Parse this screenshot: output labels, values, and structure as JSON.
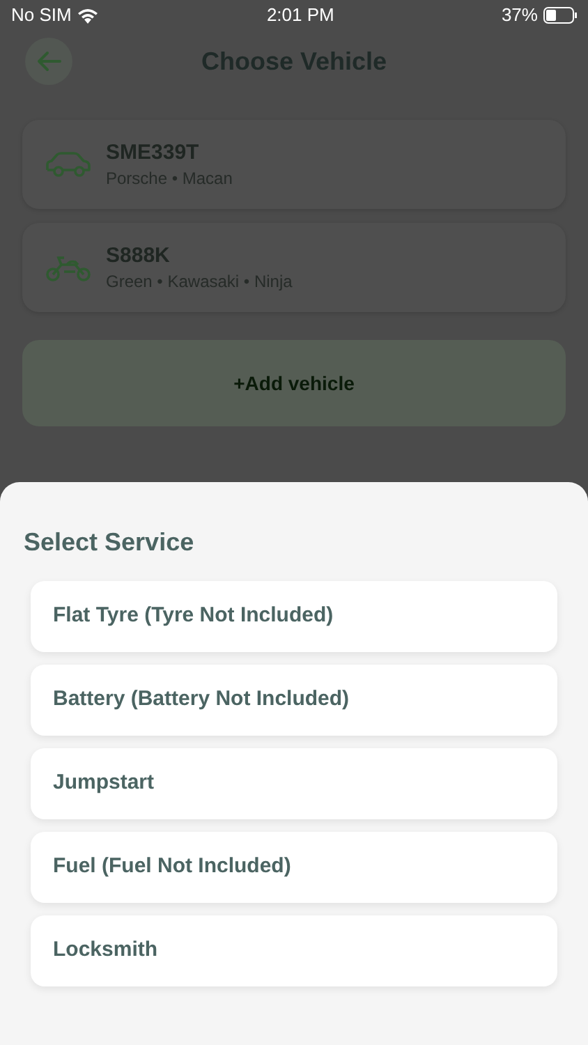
{
  "status_bar": {
    "carrier": "No SIM",
    "time": "2:01 PM",
    "battery": "37%"
  },
  "header": {
    "title": "Choose Vehicle"
  },
  "vehicles": [
    {
      "kind": "car",
      "plate": "SME339T",
      "details": "Porsche • Macan"
    },
    {
      "kind": "motorcycle",
      "plate": "S888K",
      "details": "Green • Kawasaki • Ninja"
    }
  ],
  "add_button": "+Add vehicle",
  "sheet": {
    "title": "Select Service",
    "services": [
      "Flat Tyre (Tyre Not Included)",
      "Battery (Battery Not Included)",
      "Jumpstart",
      "Fuel (Fuel Not Included)",
      "Locksmith"
    ]
  }
}
